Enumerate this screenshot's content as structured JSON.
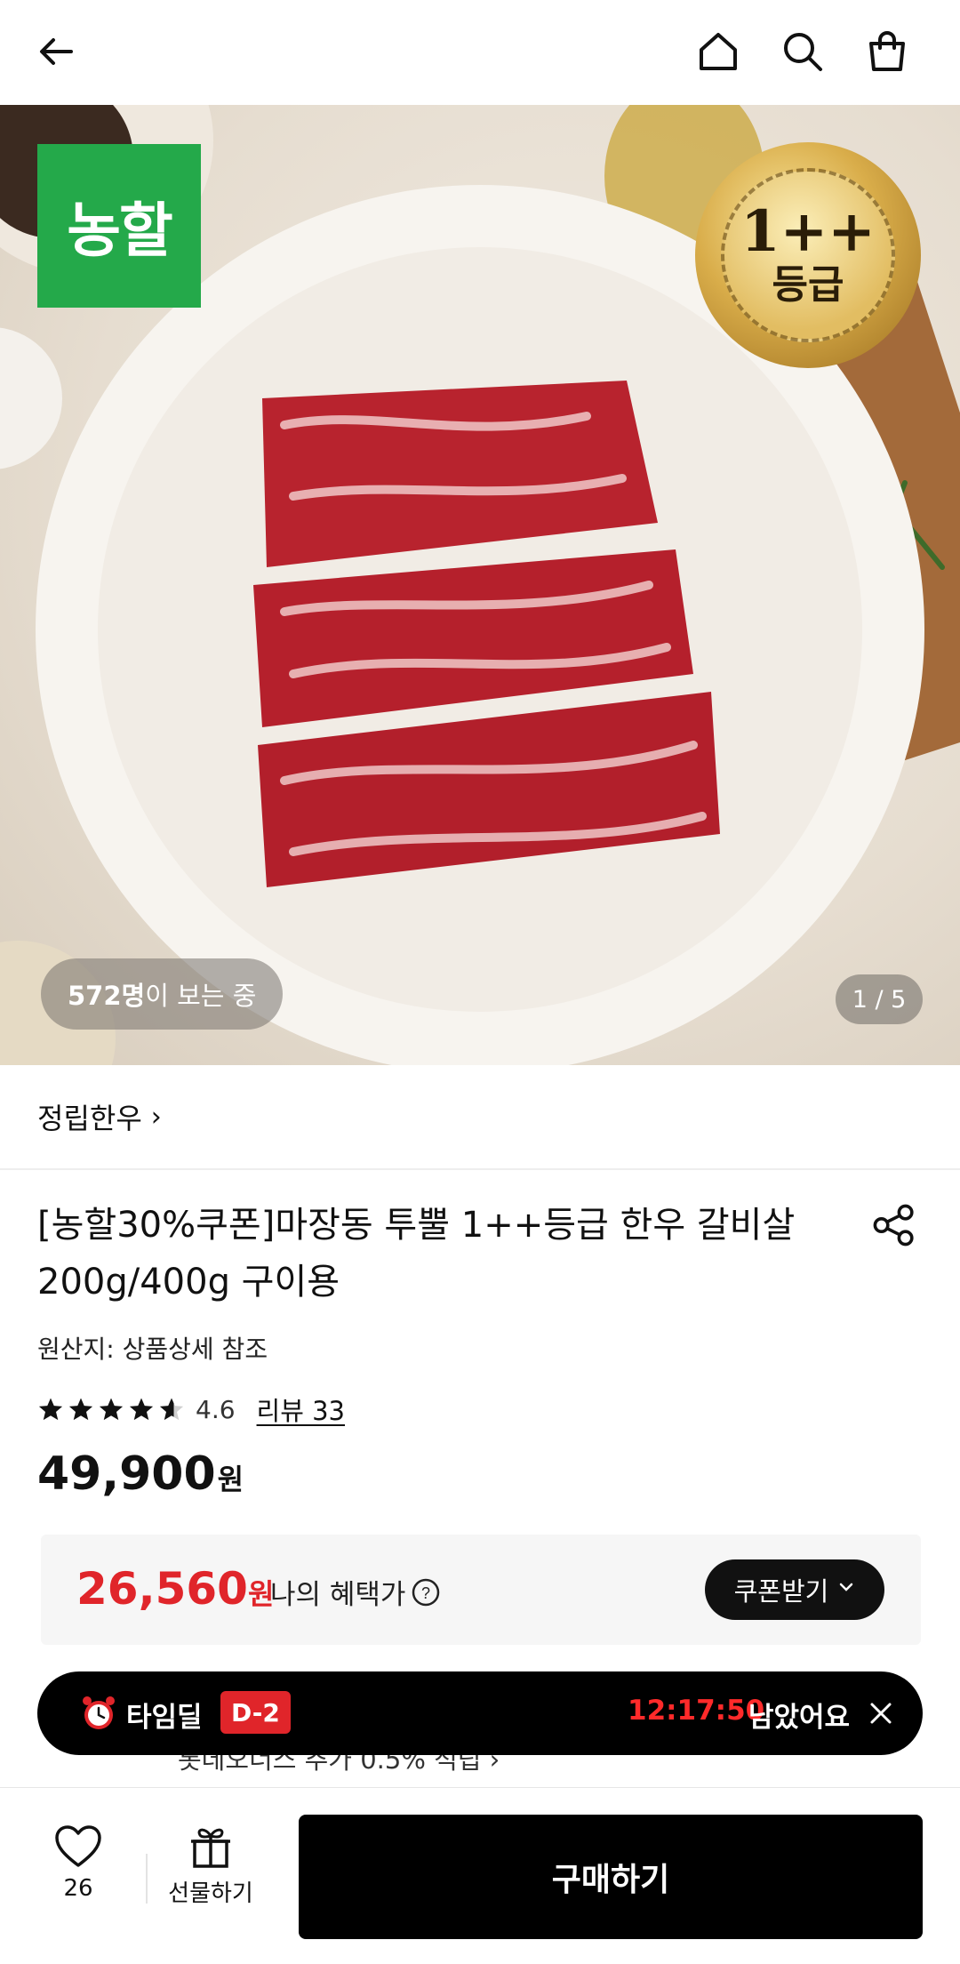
{
  "header": {
    "back_icon": "arrow-left-icon",
    "home_icon": "home-icon",
    "search_icon": "search-icon",
    "cart_icon": "shopping-bag-icon"
  },
  "hero": {
    "brand_logo_text": "농할",
    "grade_badge_top": "1++",
    "grade_badge_bottom": "등급",
    "viewers_count": "572명",
    "viewers_suffix": "이 보는 중",
    "page_indicator": "1 / 5"
  },
  "store": {
    "name": "정립한우",
    "chevron": "›"
  },
  "product": {
    "title": "[농할30%쿠폰]마장동 투뿔 1++등급 한우 갈비살 200g/400g 구이용",
    "origin": "원산지: 상품상세 참조",
    "rating": 4.6,
    "rating_text": "4.6",
    "review_link": "리뷰 33",
    "price": "49,900",
    "price_unit": "원"
  },
  "benefit": {
    "price": "26,560",
    "price_unit": "원",
    "label": "나의 혜택가",
    "coupon_button": "쿠폰받기",
    "accent_color": "#e0252a"
  },
  "points_text": "롯데오너스 추가 0.5% 적립 ›",
  "timedeal": {
    "label": "타임딜",
    "d_badge": "D-2",
    "countdown": "12:17:50",
    "remain_text": "남았어요"
  },
  "bottom_bar": {
    "like_count": "26",
    "gift_label": "선물하기",
    "buy_label": "구매하기"
  }
}
